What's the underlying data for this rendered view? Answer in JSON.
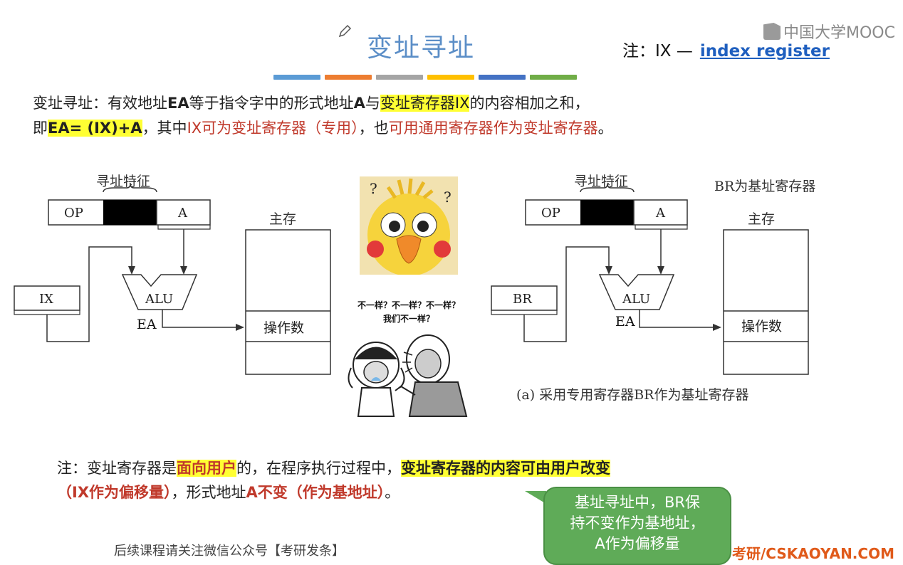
{
  "title": "变址寻址",
  "note_top": {
    "prefix": "注：IX —",
    "link": "index register"
  },
  "logo": "中国大学MOOC",
  "color_bars": [
    "#5b9bd5",
    "#ed7d31",
    "#a5a5a5",
    "#ffc000",
    "#4472c4",
    "#70ad47"
  ],
  "para1": {
    "line1_a": "变址寻址：有效地址",
    "line1_b": "EA",
    "line1_c": "等于指令字中的形式地址",
    "line1_d": "A",
    "line1_e": "与",
    "line1_hl": "变址寄存器IX",
    "line1_f": "的内容相加之和，",
    "line2_a": "即",
    "line2_hl": "EA= (IX)+A",
    "line2_b": "，其中",
    "line2_red1": "IX可为变址寄存器（专用）",
    "line2_c": "，也",
    "line2_red2": "可用通用寄存器作为变址寄存器",
    "line2_d": "。"
  },
  "left_diagram": {
    "feature_label": "寻址特征",
    "op": "OP",
    "a": "A",
    "ix": "IX",
    "alu": "ALU",
    "ea": "EA",
    "memory_title": "主存",
    "operand": "操作数"
  },
  "right_diagram": {
    "feature_label": "寻址特征",
    "br_note": "BR为基址寄存器",
    "op": "OP",
    "a": "A",
    "br": "BR",
    "alu": "ALU",
    "ea": "EA",
    "memory_title": "主存",
    "operand": "操作数",
    "caption": "(a) 采用专用寄存器BR作为基址寄存器"
  },
  "meme": {
    "line1": "不一样？不一样？不一样？",
    "line2": "我们不一样？"
  },
  "note_bottom": {
    "a": "注：变址寄存器是",
    "hl1": "面向用户",
    "b": "的，在程序执行过程中，",
    "hl2": "变址寄存器的内容可由用户改变",
    "red": "（IX作为偏移量）",
    "c": "，形式地址",
    "red2": "A不变（作为基地址）",
    "d": "。"
  },
  "speech": {
    "line1": "基址寻址中，BR保",
    "line2": "持不变作为基地址，",
    "line3": "A作为偏移量"
  },
  "footer": "后续课程请关注微信公众号【考研发条】",
  "footer_right": "考研/CSKAOYAN.COM"
}
